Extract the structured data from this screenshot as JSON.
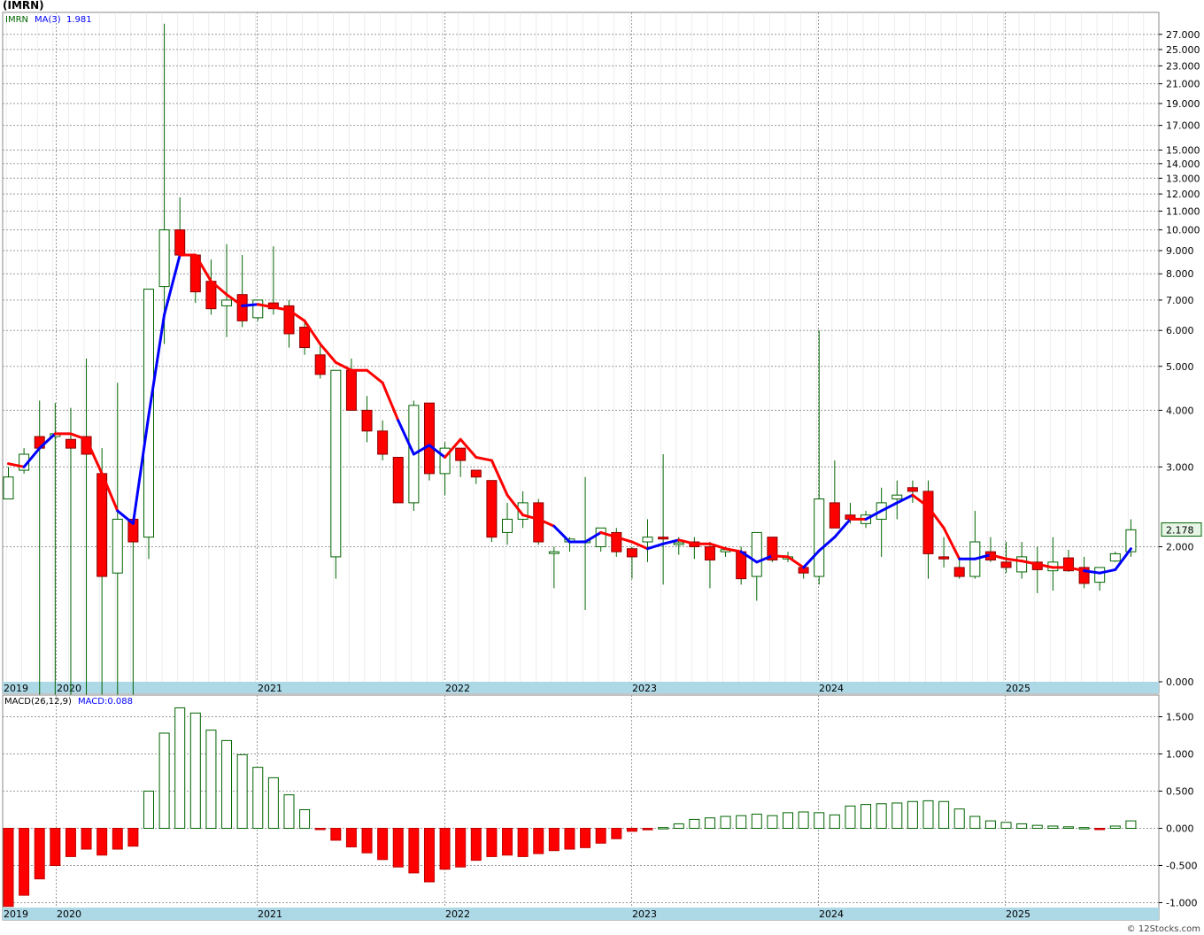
{
  "ticker": "(IMRN)",
  "watermark": "© 12Stocks.com",
  "colors": {
    "up": "#006400",
    "down": "#ff0000",
    "ma_up": "#0000ff",
    "ma_down": "#ff0000",
    "grid": "#9a9a9a",
    "axisband": "#add8e6"
  },
  "chart_data": [
    {
      "type": "candlestick",
      "legend": {
        "symbol": "IMRN",
        "ma_label": "MA(3)",
        "ma_value": "1.981"
      },
      "scale": "log",
      "y_ticks": [
        "27.000",
        "25.000",
        "23.000",
        "21.000",
        "19.000",
        "17.000",
        "15.000",
        "14.000",
        "13.000",
        "12.000",
        "11.000",
        "10.000",
        "9.000",
        "8.000",
        "7.000",
        "6.000",
        "5.000",
        "4.000",
        "3.000",
        "2.000",
        "0.000"
      ],
      "x_ticks": [
        "2019",
        "2020",
        "2021",
        "2022",
        "2023",
        "2024",
        "2025"
      ],
      "last_price_label": "2.178",
      "candles": [
        [
          2.55,
          3.0,
          2.62,
          2.85
        ],
        [
          2.95,
          3.3,
          2.9,
          3.2
        ],
        [
          3.5,
          4.2,
          0.5,
          3.3
        ],
        [
          3.5,
          4.15,
          0.5,
          3.55
        ],
        [
          3.45,
          4.05,
          0.5,
          3.3
        ],
        [
          3.5,
          5.2,
          0.5,
          3.2
        ],
        [
          2.9,
          3.3,
          0.5,
          1.72
        ],
        [
          1.75,
          4.6,
          0.5,
          2.3
        ],
        [
          2.3,
          2.3,
          0.5,
          2.05
        ],
        [
          2.1,
          6.8,
          1.88,
          7.4
        ],
        [
          7.5,
          28.5,
          5.6,
          10.0
        ],
        [
          10.0,
          11.8,
          8.8,
          8.8
        ],
        [
          8.8,
          8.8,
          6.9,
          7.3
        ],
        [
          7.7,
          8.6,
          6.5,
          6.7
        ],
        [
          6.8,
          9.3,
          5.8,
          7.0
        ],
        [
          7.2,
          8.8,
          6.1,
          6.3
        ],
        [
          6.4,
          7.0,
          6.3,
          7.0
        ],
        [
          6.9,
          9.2,
          6.5,
          6.7
        ],
        [
          6.8,
          7.0,
          5.5,
          5.9
        ],
        [
          6.1,
          6.3,
          5.3,
          5.5
        ],
        [
          5.3,
          5.6,
          4.7,
          4.8
        ],
        [
          1.9,
          4.9,
          1.7,
          4.9
        ],
        [
          4.9,
          5.2,
          4.0,
          4.0
        ],
        [
          4.0,
          4.3,
          3.4,
          3.6
        ],
        [
          3.6,
          3.8,
          3.1,
          3.2
        ],
        [
          3.15,
          3.15,
          2.5,
          2.5
        ],
        [
          2.5,
          4.2,
          2.4,
          4.1
        ],
        [
          4.15,
          4.15,
          2.8,
          2.9
        ],
        [
          2.9,
          3.4,
          2.6,
          3.3
        ],
        [
          3.3,
          3.3,
          2.85,
          3.1
        ],
        [
          2.95,
          2.95,
          2.75,
          2.85
        ],
        [
          2.8,
          2.8,
          2.05,
          2.1
        ],
        [
          2.15,
          2.5,
          2.02,
          2.3
        ],
        [
          2.3,
          2.65,
          2.2,
          2.5
        ],
        [
          2.5,
          2.55,
          2.02,
          2.05
        ],
        [
          1.95,
          2.0,
          1.62,
          1.95
        ],
        [
          2.05,
          2.1,
          1.95,
          2.08
        ],
        [
          2.05,
          2.85,
          1.45,
          2.06
        ],
        [
          2.0,
          2.2,
          1.95,
          2.2
        ],
        [
          2.15,
          2.2,
          1.9,
          1.95
        ],
        [
          1.98,
          2.0,
          1.7,
          1.9
        ],
        [
          2.05,
          2.3,
          1.85,
          2.1
        ],
        [
          2.1,
          3.2,
          1.65,
          2.08
        ],
        [
          2.03,
          2.1,
          1.92,
          2.04
        ],
        [
          2.05,
          2.1,
          1.88,
          2.0
        ],
        [
          2.0,
          2.05,
          1.62,
          1.87
        ],
        [
          1.95,
          2.0,
          1.9,
          1.97
        ],
        [
          1.95,
          2.0,
          1.65,
          1.7
        ],
        [
          1.72,
          2.15,
          1.52,
          2.15
        ],
        [
          2.1,
          2.1,
          1.85,
          1.87
        ],
        [
          1.88,
          1.95,
          1.85,
          1.9
        ],
        [
          1.8,
          1.8,
          1.7,
          1.75
        ],
        [
          1.72,
          6.0,
          1.65,
          2.55
        ],
        [
          2.5,
          3.1,
          2.2,
          2.2
        ],
        [
          2.35,
          2.5,
          2.25,
          2.3
        ],
        [
          2.25,
          2.4,
          2.2,
          2.35
        ],
        [
          2.3,
          2.7,
          1.9,
          2.5
        ],
        [
          2.55,
          2.8,
          2.3,
          2.6
        ],
        [
          2.7,
          2.8,
          2.5,
          2.65
        ],
        [
          2.65,
          2.8,
          1.7,
          1.93
        ],
        [
          1.9,
          2.1,
          1.8,
          1.88
        ],
        [
          1.8,
          1.9,
          1.7,
          1.72
        ],
        [
          1.72,
          2.4,
          1.7,
          2.05
        ],
        [
          1.95,
          2.1,
          1.85,
          1.87
        ],
        [
          1.85,
          2.05,
          1.75,
          1.8
        ],
        [
          1.76,
          2.05,
          1.7,
          1.9
        ],
        [
          1.85,
          2.0,
          1.58,
          1.78
        ],
        [
          1.77,
          2.1,
          1.6,
          1.85
        ],
        [
          1.89,
          1.97,
          1.76,
          1.77
        ],
        [
          1.8,
          1.9,
          1.62,
          1.66
        ],
        [
          1.67,
          1.8,
          1.6,
          1.8
        ],
        [
          1.86,
          1.95,
          1.85,
          1.93
        ],
        [
          1.95,
          2.3,
          1.9,
          2.18
        ]
      ],
      "ma3": [
        3.05,
        3.0,
        3.3,
        3.55,
        3.55,
        3.45,
        2.9,
        2.4,
        2.25,
        3.9,
        6.5,
        8.8,
        8.8,
        7.7,
        7.2,
        6.8,
        6.85,
        6.75,
        6.65,
        6.3,
        5.6,
        5.1,
        4.9,
        4.9,
        4.6,
        3.8,
        3.2,
        3.35,
        3.15,
        3.45,
        3.15,
        3.1,
        2.6,
        2.35,
        2.3,
        2.22,
        2.05,
        2.05,
        2.15,
        2.1,
        2.05,
        1.98,
        2.03,
        2.07,
        2.03,
        2.03,
        1.98,
        1.95,
        1.85,
        1.91,
        1.9,
        1.8,
        1.96,
        2.1,
        2.3,
        2.3,
        2.4,
        2.5,
        2.6,
        2.45,
        2.2,
        1.88,
        1.88,
        1.92,
        1.88,
        1.86,
        1.83,
        1.8,
        1.8,
        1.77,
        1.75,
        1.78,
        1.98
      ],
      "ma_dir": [
        "d",
        "d",
        "u",
        "u",
        "d",
        "d",
        "d",
        "d",
        "u",
        "u",
        "u",
        "u",
        "d",
        "d",
        "d",
        "d",
        "u",
        "d",
        "d",
        "d",
        "d",
        "d",
        "d",
        "d",
        "d",
        "d",
        "u",
        "u",
        "u",
        "d",
        "d",
        "d",
        "d",
        "d",
        "d",
        "d",
        "u",
        "u",
        "u",
        "d",
        "d",
        "d",
        "u",
        "u",
        "d",
        "d",
        "d",
        "d",
        "u",
        "u",
        "d",
        "d",
        "u",
        "u",
        "u",
        "d",
        "u",
        "u",
        "u",
        "d",
        "d",
        "d",
        "u",
        "u",
        "d",
        "d",
        "d",
        "d",
        "d",
        "d",
        "u",
        "u",
        "u"
      ]
    },
    {
      "type": "bar",
      "legend": {
        "name": "MACD(26,12,9)",
        "value_label": "MACD:0.088"
      },
      "y_ticks": [
        "1.500",
        "1.000",
        "0.500",
        "0.000",
        "-0.500",
        "-1.000"
      ],
      "ylim": [
        -1.05,
        1.65
      ],
      "values": [
        -1.05,
        -0.9,
        -0.68,
        -0.5,
        -0.38,
        -0.28,
        -0.36,
        -0.28,
        -0.24,
        0.5,
        1.28,
        1.62,
        1.55,
        1.32,
        1.18,
        0.99,
        0.82,
        0.68,
        0.45,
        0.25,
        -0.01,
        -0.16,
        -0.25,
        -0.33,
        -0.42,
        -0.52,
        -0.6,
        -0.72,
        -0.55,
        -0.52,
        -0.43,
        -0.38,
        -0.36,
        -0.38,
        -0.34,
        -0.3,
        -0.28,
        -0.26,
        -0.2,
        -0.14,
        -0.04,
        -0.02,
        0.01,
        0.06,
        0.12,
        0.14,
        0.16,
        0.17,
        0.19,
        0.17,
        0.21,
        0.22,
        0.21,
        0.18,
        0.3,
        0.32,
        0.33,
        0.34,
        0.36,
        0.37,
        0.36,
        0.26,
        0.16,
        0.1,
        0.08,
        0.06,
        0.04,
        0.03,
        0.02,
        0.01,
        -0.01,
        0.03,
        0.1
      ]
    }
  ]
}
